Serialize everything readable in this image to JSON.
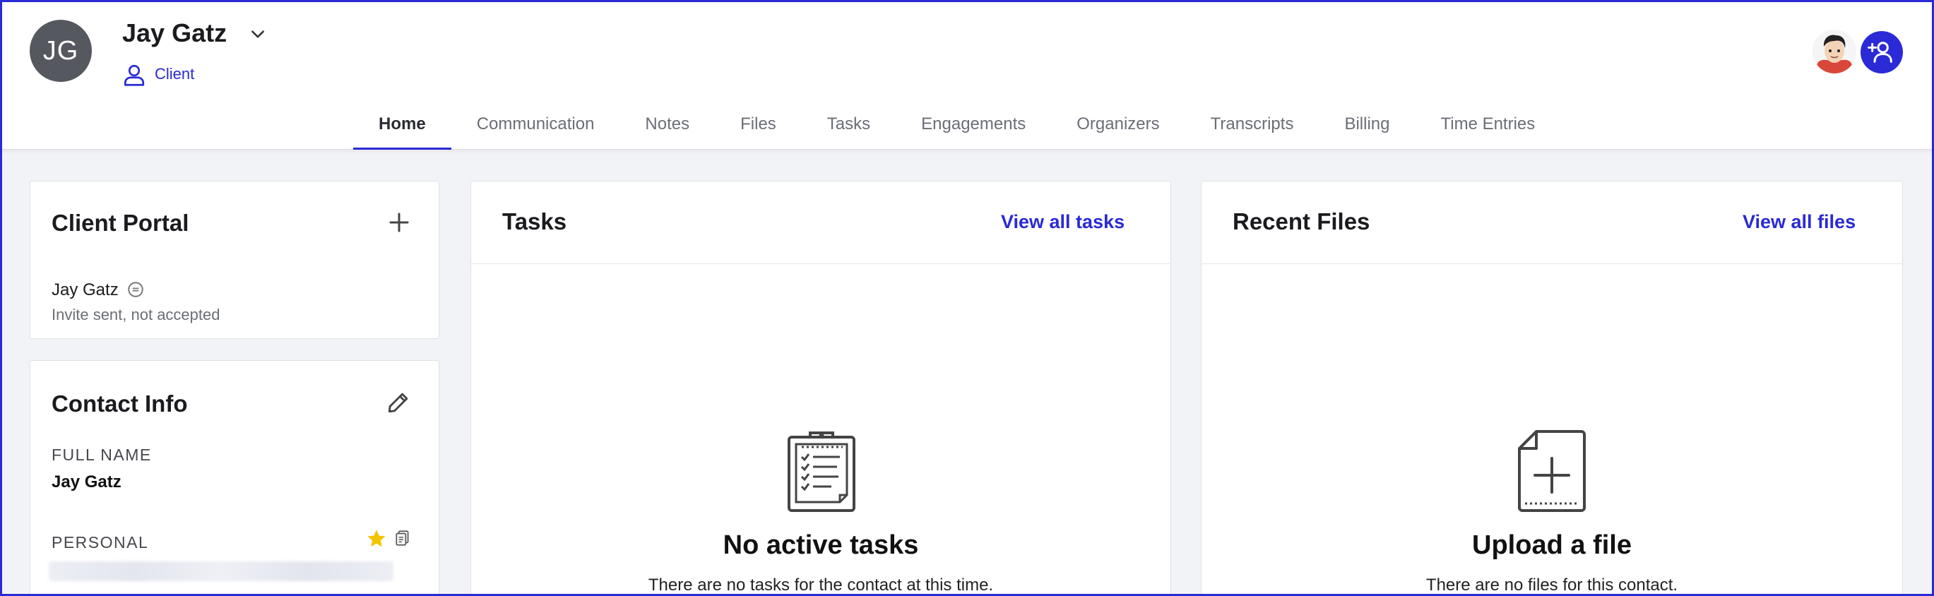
{
  "contact": {
    "initials": "JG",
    "name": "Jay Gatz",
    "type": "Client"
  },
  "colors": {
    "accent": "#2a2ad6",
    "avatar_bg": "#55585e",
    "star": "#f2c500"
  },
  "tabs": [
    {
      "label": "Home",
      "active": true
    },
    {
      "label": "Communication",
      "active": false
    },
    {
      "label": "Notes",
      "active": false
    },
    {
      "label": "Files",
      "active": false
    },
    {
      "label": "Tasks",
      "active": false
    },
    {
      "label": "Engagements",
      "active": false
    },
    {
      "label": "Organizers",
      "active": false
    },
    {
      "label": "Transcripts",
      "active": false
    },
    {
      "label": "Billing",
      "active": false
    },
    {
      "label": "Time Entries",
      "active": false
    }
  ],
  "client_portal": {
    "title": "Client Portal",
    "user_name": "Jay Gatz",
    "status": "Invite sent, not accepted"
  },
  "contact_info": {
    "title": "Contact Info",
    "full_name_label": "FULL NAME",
    "full_name_value": "Jay Gatz",
    "personal_label": "PERSONAL"
  },
  "tasks_card": {
    "title": "Tasks",
    "view_all": "View all tasks",
    "empty_title": "No active tasks",
    "empty_sub": "There are no tasks for the contact at this time."
  },
  "files_card": {
    "title": "Recent Files",
    "view_all": "View all files",
    "empty_title": "Upload a file",
    "empty_sub": "There are no files for this contact."
  },
  "icons": {
    "chevron": "chevron-down-icon",
    "client": "user-icon",
    "add_user": "add-user-icon",
    "plus": "plus-icon",
    "edit": "pencil-icon",
    "star": "star-icon",
    "copy": "copy-icon",
    "clipboard": "clipboard-icon",
    "file_add": "file-add-icon",
    "status": "status-icon"
  }
}
